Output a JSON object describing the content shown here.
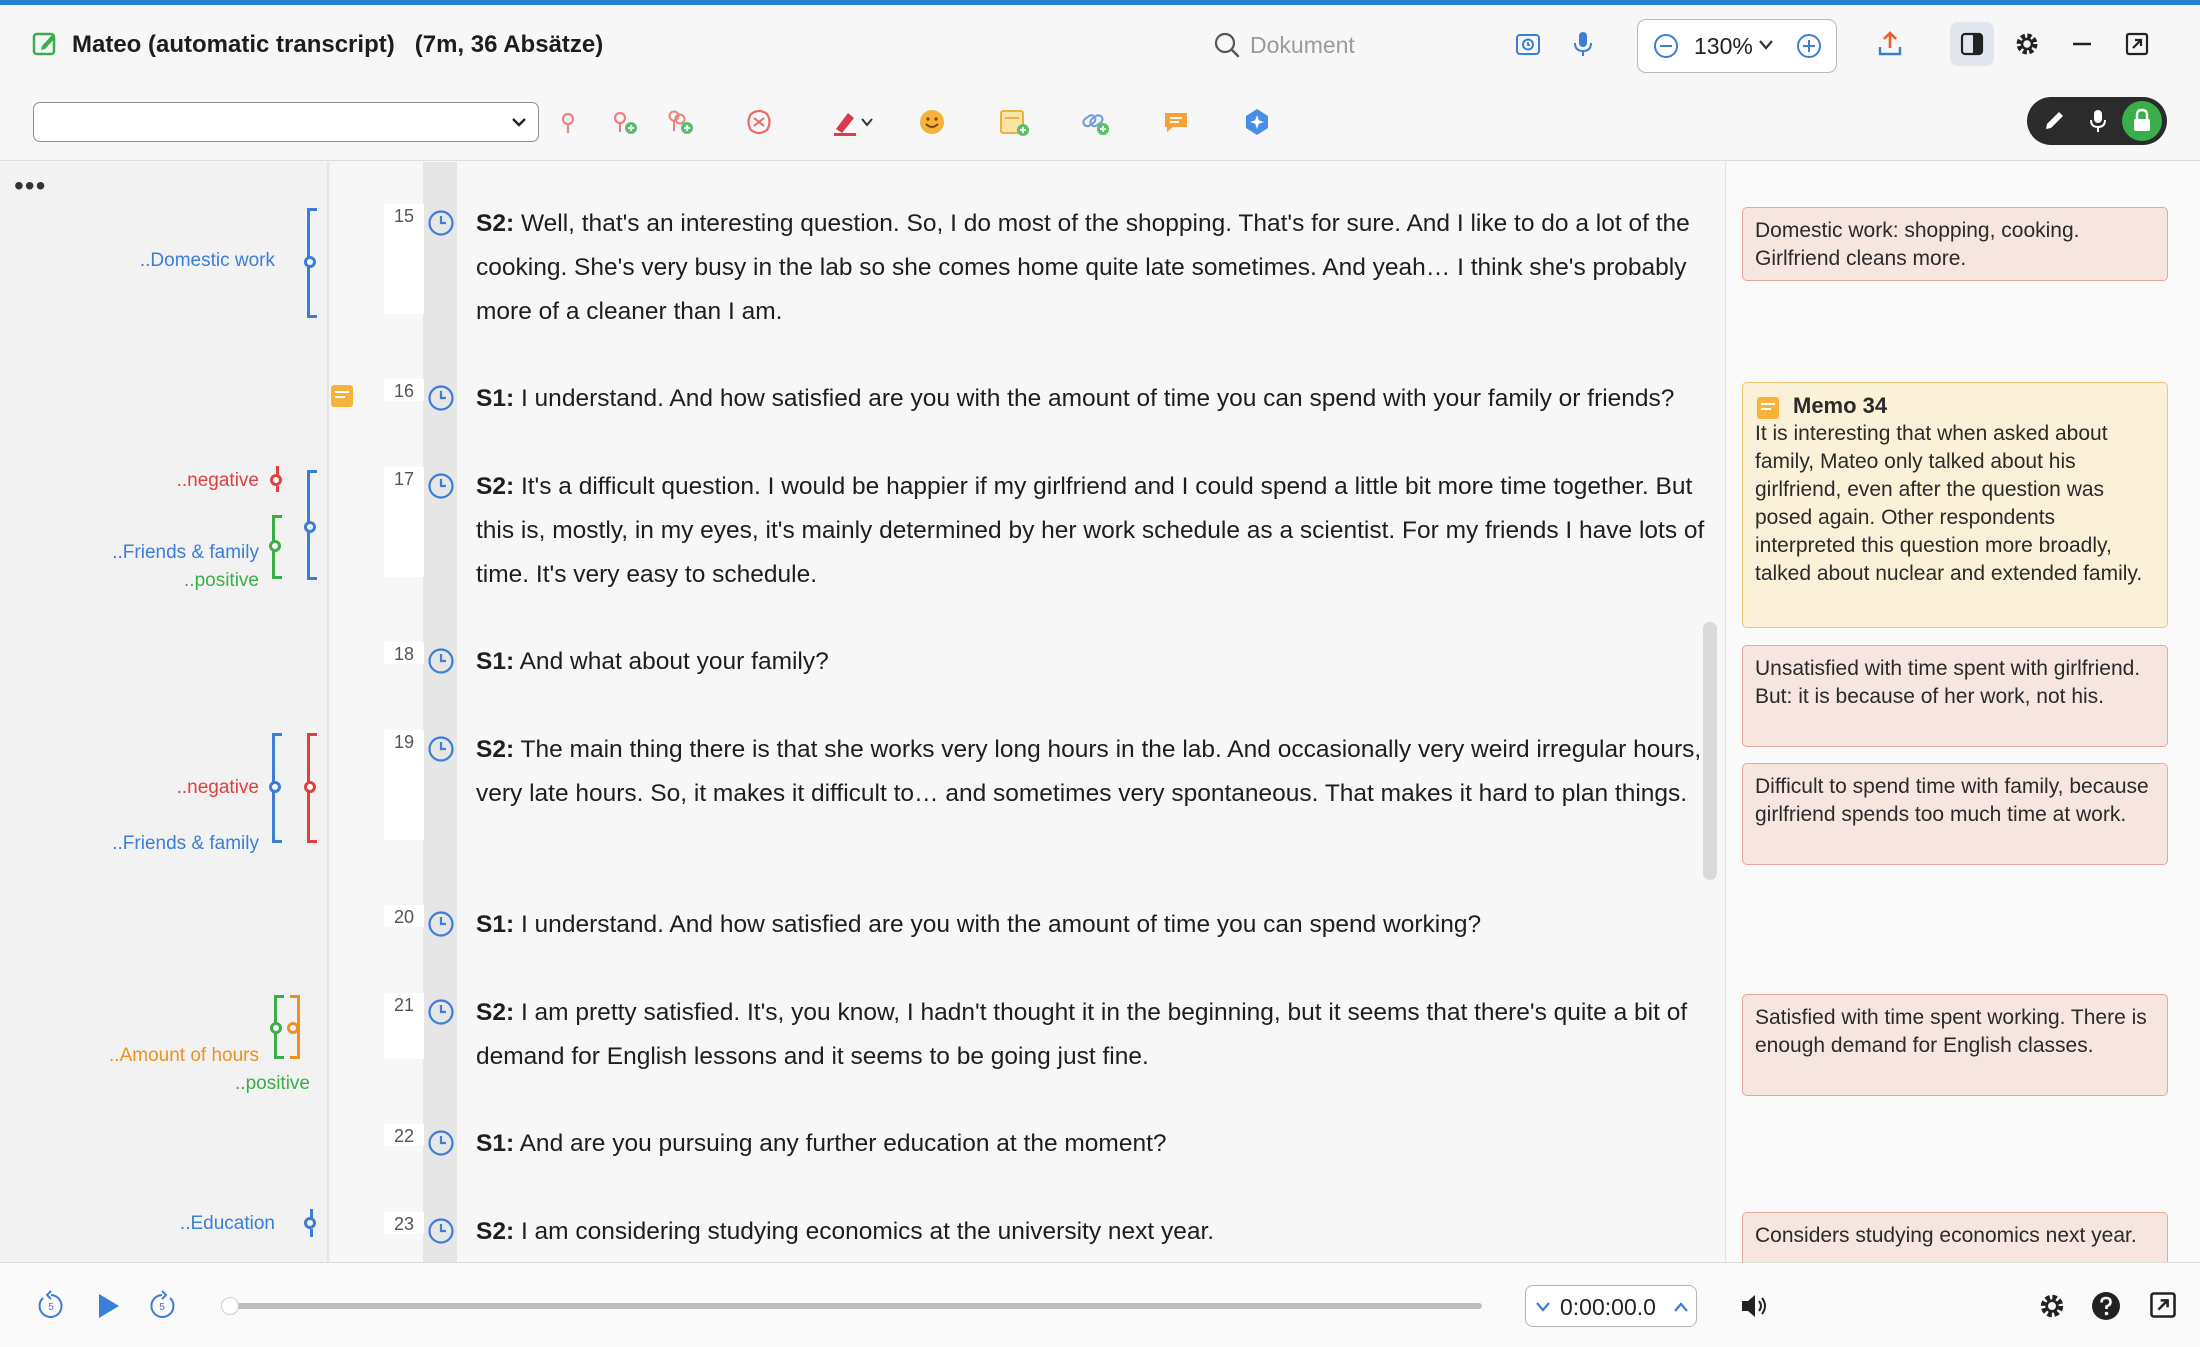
{
  "window": {
    "title": "Mateo (automatic transcript)",
    "subtitle": "(7m, 36 Absätze)"
  },
  "header": {
    "search_placeholder": "Dokument",
    "zoom": "130%"
  },
  "toolbar": {
    "code_selector_value": "",
    "tools": [
      "pin-icon",
      "add-code-icon",
      "add-multiple-codes-icon",
      "code-brain-icon",
      "highlighter-icon",
      "emoji-icon",
      "add-memo-icon",
      "link-icon",
      "comment-icon",
      "ai-assist-icon"
    ]
  },
  "margin": {
    "codes": [
      {
        "label": "..Domestic work",
        "color": "#3b7ed8"
      },
      {
        "label": "..negative",
        "color": "#e0403e"
      },
      {
        "label": "..Friends & family",
        "color": "#3b7ed8"
      },
      {
        "label": "..positive",
        "color": "#3aae48"
      },
      {
        "label": "..negative",
        "color": "#e0403e"
      },
      {
        "label": "..Friends & family",
        "color": "#3b7ed8"
      },
      {
        "label": "..Amount of hours",
        "color": "#f0901e"
      },
      {
        "label": "..positive",
        "color": "#3aae48"
      },
      {
        "label": "..Education",
        "color": "#3b7ed8"
      }
    ]
  },
  "transcript": {
    "paragraphs": [
      {
        "num": "15",
        "speaker": "S2:",
        "text": " Well, that's an interesting question. So, I do most of the shopping. That's for sure. And I like to do a lot of the cooking. She's very busy in the lab so she comes home quite late sometimes. And yeah… I think she's probably more of a cleaner than I am."
      },
      {
        "num": "16",
        "speaker": "S1:",
        "text": " I understand. And how satisfied are you with the amount of time you can spend with your family or friends?"
      },
      {
        "num": "17",
        "speaker": "S2:",
        "text": " It's a difficult question. I would be happier if my girlfriend and I could spend a little bit more time together. But this is, mostly, in my eyes, it's mainly determined by her work schedule as a scientist. For my friends I have lots of time. It's very easy to schedule."
      },
      {
        "num": "18",
        "speaker": "S1:",
        "text": " And what about your family?"
      },
      {
        "num": "19",
        "speaker": "S2:",
        "text": " The main thing there is that she works very long hours in the lab. And occasionally very weird irregular hours, very late hours. So, it makes it difficult to… and sometimes very spontaneous. That makes it hard to plan things."
      },
      {
        "num": "20",
        "speaker": "S1:",
        "text": " I understand. And how satisfied are you with the amount of time you can spend working?"
      },
      {
        "num": "21",
        "speaker": "S2:",
        "text": " I am pretty satisfied. It's, you know, I hadn't thought it in the beginning, but it seems that there's quite a bit of demand for English lessons and it seems to be going just fine."
      },
      {
        "num": "22",
        "speaker": "S1:",
        "text": " And are you pursuing any further education at the moment?"
      },
      {
        "num": "23",
        "speaker": "S2:",
        "text": " I am considering studying economics at the university next year."
      }
    ]
  },
  "memos": [
    {
      "text": "Domestic work: shopping, cooking. Girlfriend cleans more."
    },
    {
      "title": "Memo 34",
      "text": "It is interesting that when asked about family, Mateo only talked about his girlfriend, even after the question was posed again. Other respondents interpreted this question more broadly, talked about nuclear and extended family."
    },
    {
      "text": "Unsatisfied with time spent with girlfriend. But: it is because of her work, not his."
    },
    {
      "text": "Difficult to spend time with family, because girlfriend spends too much time at work."
    },
    {
      "text": "Satisfied with time spent working. There is enough demand for English classes."
    },
    {
      "text": "Considers studying economics next year."
    }
  ],
  "media": {
    "time": "0:00:00.0",
    "progress": 0,
    "skip_back_seconds": "5",
    "skip_forward_seconds": "5"
  },
  "colors": {
    "accent": "#2b7fd6",
    "code_blue": "#3b7ed8",
    "code_red": "#e0403e",
    "code_green": "#3aae48",
    "code_orange": "#f0901e",
    "memo_bg": "#f7e5e0",
    "memo_yellow_bg": "#fbf1d8"
  }
}
